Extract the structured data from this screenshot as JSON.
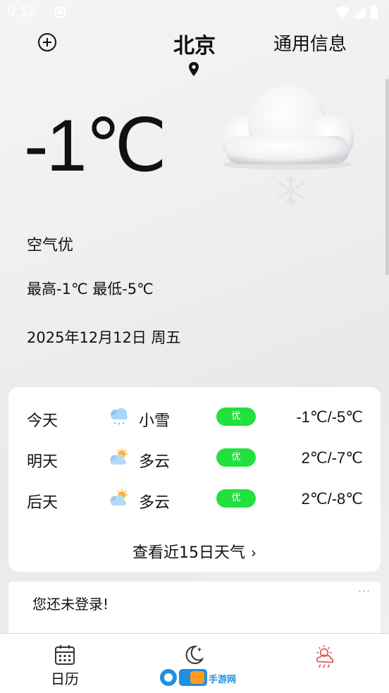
{
  "status_bar": {
    "time": "9:12",
    "a_icon": "A"
  },
  "header": {
    "add_icon": "plus-circle-icon",
    "city": "北京",
    "location_icon": "map-pin-icon",
    "general_info": "通用信息"
  },
  "current": {
    "temperature": "-1℃",
    "condition_icon": "cloud-snow-icon",
    "air_quality": "空气优",
    "high_low": "最高-1℃ 最低-5℃",
    "date": "2025年12月12日 周五"
  },
  "forecast": {
    "rows": [
      {
        "day": "今天",
        "icon": "light-snow-icon",
        "condition": "小雪",
        "aqi": "优",
        "temp": "-1℃/-5℃"
      },
      {
        "day": "明天",
        "icon": "partly-cloudy-icon",
        "condition": "多云",
        "aqi": "优",
        "temp": "2℃/-7℃"
      },
      {
        "day": "后天",
        "icon": "partly-cloudy-icon",
        "condition": "多云",
        "aqi": "优",
        "temp": "2℃/-8℃"
      }
    ],
    "more_label": "查看近15日天气",
    "badge_color": "#22e03d"
  },
  "login": {
    "message": "您还未登录!",
    "more": "···"
  },
  "bottom_nav": {
    "items": [
      {
        "label": "日历",
        "icon": "calendar-icon"
      },
      {
        "label": "",
        "icon": "moon-icon"
      },
      {
        "label": "",
        "icon": "weather-icon"
      }
    ]
  },
  "watermark": {
    "text": "手游网"
  }
}
